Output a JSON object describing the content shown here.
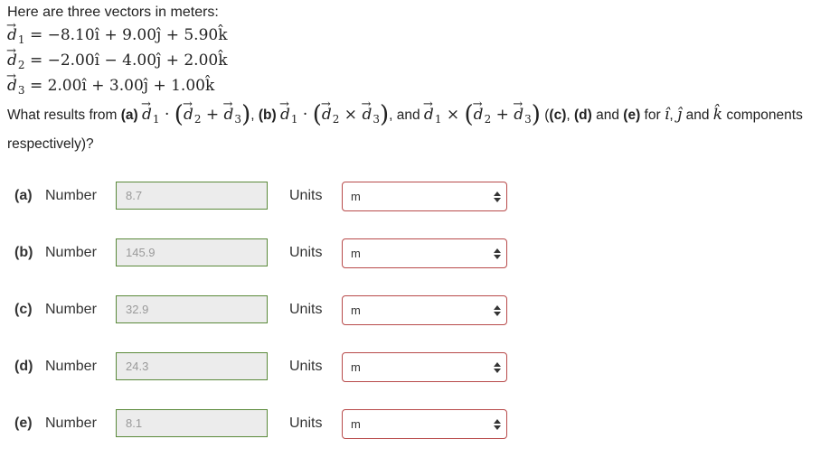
{
  "problem": {
    "intro": "Here are three vectors in meters:",
    "d1": "= −8.10î + 9.00ĵ + 5.90k̂",
    "d2": "= −2.00î − 4.00ĵ + 2.00k̂",
    "d3": "= 2.00î + 3.00ĵ + 1.00k̂",
    "question_start": "What results from",
    "question_end": "components",
    "question_tail": "respectively)?"
  },
  "rows": [
    {
      "label": "(a)",
      "number_label": "Number",
      "value": "8.7",
      "units_label": "Units",
      "unit": "m"
    },
    {
      "label": "(b)",
      "number_label": "Number",
      "value": "145.9",
      "units_label": "Units",
      "unit": "m"
    },
    {
      "label": "(c)",
      "number_label": "Number",
      "value": "32.9",
      "units_label": "Units",
      "unit": "m"
    },
    {
      "label": "(d)",
      "number_label": "Number",
      "value": "24.3",
      "units_label": "Units",
      "unit": "m"
    },
    {
      "label": "(e)",
      "number_label": "Number",
      "value": "8.1",
      "units_label": "Units",
      "unit": "m"
    }
  ],
  "colors": {
    "input_border": "#5a8a3a",
    "select_border": "#b84a4a",
    "input_bg": "#ececec"
  }
}
